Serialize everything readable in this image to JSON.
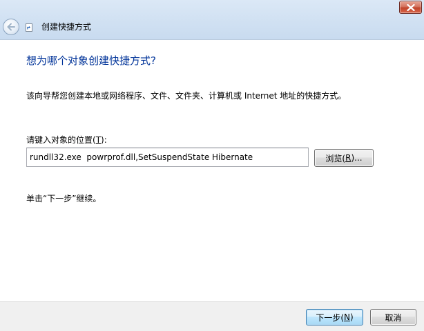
{
  "window": {
    "title": "创建快捷方式",
    "close_icon": "close-icon",
    "back_icon": "back-arrow-icon",
    "wizard_icon": "shortcut-icon"
  },
  "content": {
    "heading": "想为哪个对象创建快捷方式?",
    "description": "该向导帮您创建本地或网络程序、文件、文件夹、计算机或 Internet 地址的快捷方式。",
    "location_label_prefix": "请键入对象的位置(",
    "location_label_key": "T",
    "location_label_suffix": "):",
    "location_value": "rundll32.exe  powrprof.dll,SetSuspendState Hibernate",
    "browse_prefix": "浏览(",
    "browse_key": "R",
    "browse_suffix": ")...",
    "hint": "单击“下一步”继续。"
  },
  "footer": {
    "next_prefix": "下一步(",
    "next_key": "N",
    "next_suffix": ")",
    "cancel_label": "取消"
  },
  "colors": {
    "heading": "#003399",
    "glass": "#c7daef",
    "close_button": "#c0452c"
  }
}
